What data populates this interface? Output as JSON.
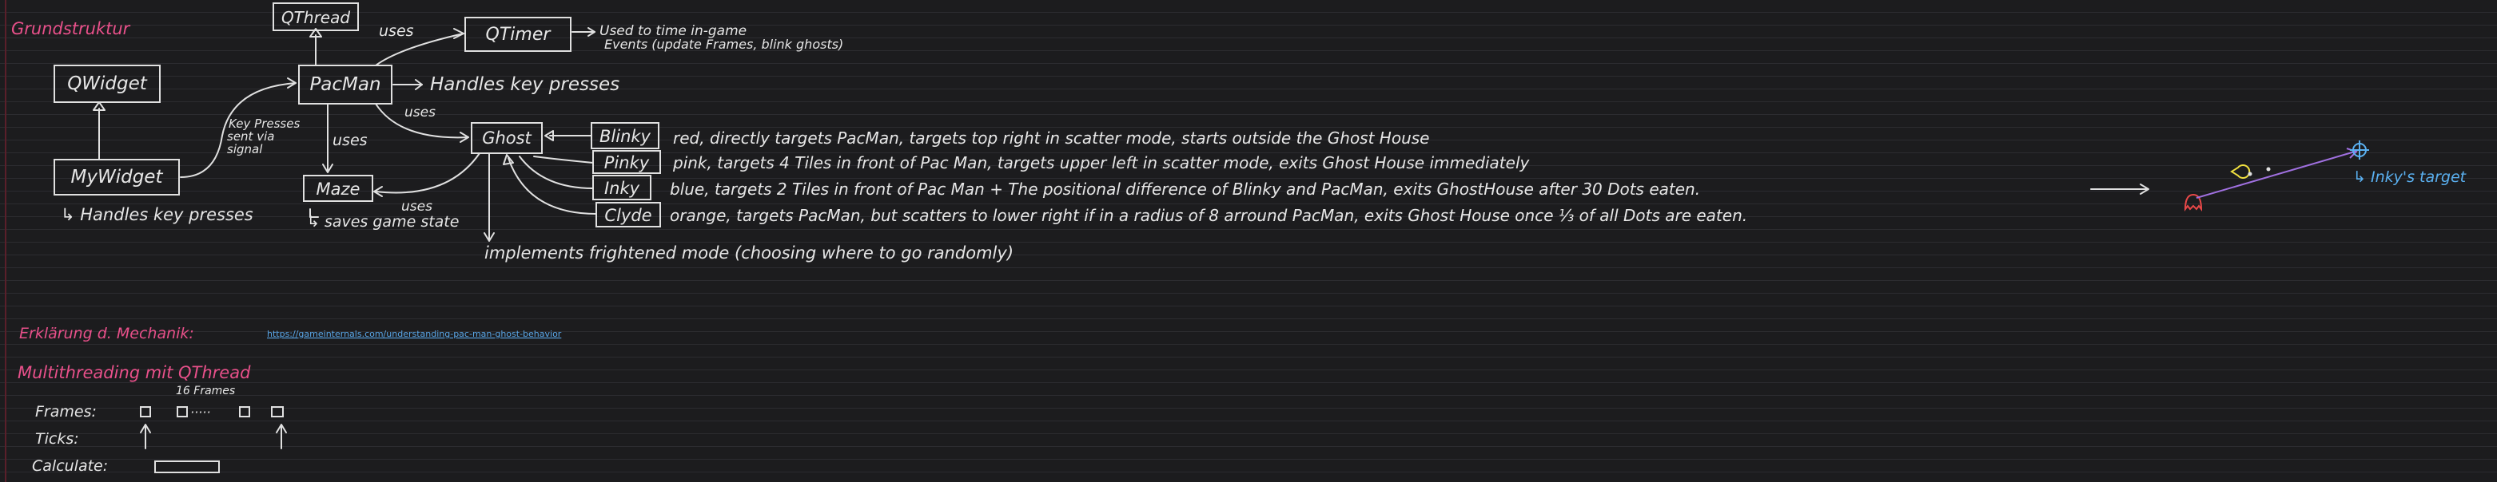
{
  "title": "Grundstruktur",
  "boxes": {
    "qthread": "QThread",
    "qtimer": "QTimer",
    "qwidget": "QWidget",
    "pacman": "PacMan",
    "mywidget": "MyWidget",
    "ghost": "Ghost",
    "maze": "Maze",
    "blinky": "Blinky",
    "pinky": "Pinky",
    "inky": "Inky",
    "clyde": "Clyde"
  },
  "labels": {
    "uses_top": "uses",
    "uses_ghost": "uses",
    "uses_maze": "uses",
    "uses_bottom": "uses",
    "qtimer_desc_1": "Used to time in-game",
    "qtimer_desc_2": "Events (update Frames, blink ghosts)",
    "pacman_desc": "Handles key presses",
    "key_presses_1": "Key Presses",
    "key_presses_2": "sent via",
    "key_presses_3": "signal",
    "mywidget_desc": "↳ Handles key presses",
    "maze_desc": "↳ saves game state",
    "blinky_desc": "red, directly targets PacMan, targets top right in scatter mode, starts outside the Ghost House",
    "pinky_desc": "pink, targets 4 Tiles in front of Pac Man, targets upper left in scatter mode, exits Ghost House immediately",
    "inky_desc": "blue, targets 2 Tiles in front of Pac Man + The positional difference of Blinky and PacMan, exits GhostHouse after 30 Dots eaten.",
    "clyde_desc": "orange, targets PacMan, but scatters to lower right if in a radius of 8 arround PacMan, exits Ghost House once ⅓ of all Dots are eaten.",
    "ghost_desc": "implements frightened mode (choosing where to go randomly)",
    "inky_target": "↳ Inky's target"
  },
  "mechanics": {
    "heading": "Erklärung d. Mechanik:",
    "link": "https://gameinternals.com/understanding-pac-man-ghost-behavior"
  },
  "threading": {
    "heading": "Multithreading mit QThread",
    "frames_count": "16 Frames",
    "frames_label": "Frames:",
    "dots": "·····",
    "ticks_label": "Ticks:",
    "calculate_label": "Calculate:"
  },
  "colors": {
    "accent_pink": "#e8508a",
    "ink": "#e6e6e6",
    "link_blue": "#5aa7e8",
    "inky_blue": "#5ab0f0",
    "clyde_red": "#e84848",
    "pacman_yellow": "#f0e040",
    "arrow_purple": "#a070e0"
  }
}
